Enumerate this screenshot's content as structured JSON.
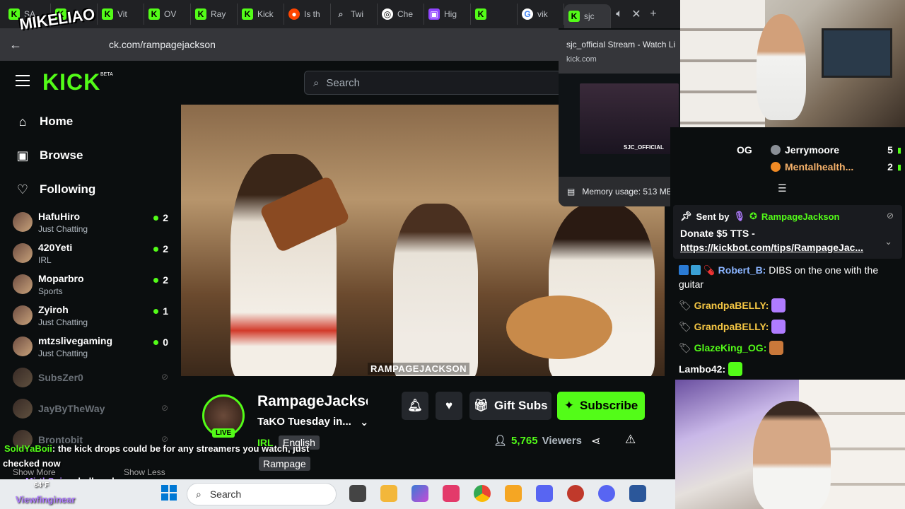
{
  "browser": {
    "tabs": [
      {
        "label": "SA",
        "icon": "kick-favicon-icon",
        "glyph": "K",
        "kind": ""
      },
      {
        "label": "",
        "icon": "kick-favicon-icon",
        "glyph": "K",
        "kind": ""
      },
      {
        "label": "Vit",
        "icon": "kick-favicon-icon",
        "glyph": "K",
        "kind": ""
      },
      {
        "label": "OV",
        "icon": "kick-favicon-icon",
        "glyph": "K",
        "kind": ""
      },
      {
        "label": "Ray",
        "icon": "kick-favicon-icon",
        "glyph": "K",
        "kind": ""
      },
      {
        "label": "Kick",
        "icon": "kick-favicon-icon",
        "glyph": "K",
        "kind": ""
      },
      {
        "label": "Is th",
        "icon": "reddit-icon",
        "glyph": "●",
        "kind": "reddit"
      },
      {
        "label": "Twi",
        "icon": "search-icon",
        "glyph": "⌕",
        "kind": "search"
      },
      {
        "label": "Che",
        "icon": "chatgpt-icon",
        "glyph": "◎",
        "kind": "chatgpt"
      },
      {
        "label": "Hig",
        "icon": "twitch-icon",
        "glyph": "▣",
        "kind": "twitch"
      },
      {
        "label": "",
        "icon": "kick-favicon-icon",
        "glyph": "K",
        "kind": ""
      },
      {
        "label": "vik",
        "icon": "google-icon",
        "glyph": "G",
        "kind": "google"
      },
      {
        "label": "sjc",
        "icon": "kick-favicon-icon",
        "glyph": "K",
        "kind": ""
      }
    ],
    "url": "ck.com/rampagejackson",
    "hover_card": {
      "title": "sjc_official Stream - Watch Li",
      "domain": "kick.com",
      "memory": "Memory usage: 513 MB",
      "thumb_label": "SJC_OFFICIAL"
    }
  },
  "watermark": "MIKELIAO",
  "kick": {
    "logo": "KICK",
    "beta": "BETA",
    "search_placeholder": "Search",
    "nav": [
      {
        "label": "Home",
        "icon": "home-icon",
        "glyph": "⌂"
      },
      {
        "label": "Browse",
        "icon": "browse-icon",
        "glyph": "▣"
      },
      {
        "label": "Following",
        "icon": "heart-icon",
        "glyph": "♡"
      }
    ],
    "following": [
      {
        "name": "HafuHiro",
        "category": "Just Chatting",
        "count": "2",
        "online": true
      },
      {
        "name": "420Yeti",
        "category": "IRL",
        "count": "2",
        "online": true
      },
      {
        "name": "Moparbro",
        "category": "Sports",
        "count": "2",
        "online": true
      },
      {
        "name": "Zyiroh",
        "category": "Just Chatting",
        "count": "1",
        "online": true
      },
      {
        "name": "mtzslivegaming",
        "category": "Just Chatting",
        "count": "0",
        "online": true
      },
      {
        "name": "SubsZer0",
        "category": "",
        "count": "",
        "online": false
      },
      {
        "name": "JayByTheWay",
        "category": "",
        "count": "",
        "online": false
      },
      {
        "name": "Brontobit",
        "category": "",
        "count": "",
        "online": false
      }
    ],
    "show_more": "Show More",
    "show_less": "Show Less"
  },
  "video": {
    "watermark_tag": "RAMPAGEJACKSON"
  },
  "stream": {
    "streamer": "RampageJackson",
    "title": "TaKO Tuesday in...",
    "category": "IRL",
    "tags": [
      "English",
      "Rampage"
    ],
    "live": "LIVE",
    "gift_subs": "Gift Subs",
    "subscribe": "Subscribe",
    "viewers_num": "5,765",
    "viewers_label": "Viewers"
  },
  "chat": {
    "leaderboard": [
      {
        "name": "Jerrymoore",
        "count": "5",
        "color": "#ffffff",
        "badge": "grey"
      },
      {
        "name": "Mentalhealth...",
        "count": "2",
        "color": "#f6b26b",
        "badge": "orange"
      }
    ],
    "lb_left": "OG",
    "pinned": {
      "sent_by": "Sent by",
      "sender": "RampageJackson",
      "line1": "Donate $5 TTS -",
      "link": "https://kickbot.com/tips/RampageJac..."
    },
    "messages": [
      {
        "user": "Robert_B:",
        "text": "DIBS on the one with the guitar",
        "color": "#8ab4ff"
      },
      {
        "user": "GrandpaBELLY:",
        "text": "",
        "color": "#f6c744"
      },
      {
        "user": "GrandpaBELLY:",
        "text": "",
        "color": "#f6c744"
      },
      {
        "user": "GlazeKing_OG:",
        "text": "",
        "color": "#53fc18"
      },
      {
        "user": "Lambo42:",
        "text": "",
        "color": "#ffffff"
      }
    ]
  },
  "overlay_chat": {
    "line1_user": "SoldYaBoii",
    "line1_text": ": the kick drops could be for any streamers you watch, just",
    "line2_text": "checked now",
    "line3_user": "MirthSpicy",
    "line3_text": ": hell yeah",
    "line4_user": "Viewfinginear",
    "temp": "64°F"
  },
  "taskbar": {
    "search": "Search"
  }
}
